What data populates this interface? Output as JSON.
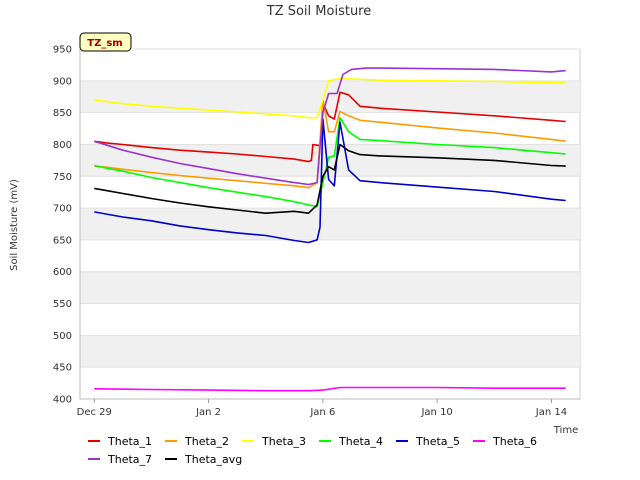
{
  "chart_data": {
    "type": "line",
    "title": "TZ Soil Moisture",
    "badge": "TZ_sm",
    "xlabel": "Time",
    "ylabel": "Soil Moisture (mV)",
    "ylim": [
      400,
      950
    ],
    "yticks": [
      400,
      450,
      500,
      550,
      600,
      650,
      700,
      750,
      800,
      850,
      900,
      950
    ],
    "xlim": [
      -0.5,
      17.0
    ],
    "xticks": [
      {
        "label": "Dec 29",
        "value": 0
      },
      {
        "label": "Jan 2",
        "value": 4
      },
      {
        "label": "Jan 6",
        "value": 8
      },
      {
        "label": "Jan 10",
        "value": 12
      },
      {
        "label": "Jan 14",
        "value": 16
      }
    ],
    "grid": "horizontal bands",
    "legend_position": "bottom",
    "series": [
      {
        "name": "Theta_1",
        "color": "#e60000",
        "x": [
          0,
          0.5,
          1,
          2,
          3,
          4,
          5,
          6,
          7,
          7.5,
          7.6,
          7.65,
          7.9,
          8.0,
          8.2,
          8.4,
          8.6,
          8.9,
          9.3,
          10,
          12,
          14,
          16,
          16.5
        ],
        "y": [
          805,
          802,
          800,
          795,
          791,
          788,
          785,
          781,
          777,
          773,
          775,
          800,
          798,
          865,
          845,
          840,
          882,
          878,
          860,
          857,
          851,
          845,
          838,
          836
        ]
      },
      {
        "name": "Theta_2",
        "color": "#ff9900",
        "x": [
          0,
          0.5,
          1,
          2,
          3,
          4,
          5,
          6,
          7,
          7.5,
          7.8,
          8.0,
          8.2,
          8.4,
          8.6,
          8.9,
          9.3,
          10,
          12,
          14,
          16,
          16.5
        ],
        "y": [
          766,
          764,
          761,
          756,
          751,
          747,
          743,
          739,
          735,
          732,
          740,
          870,
          820,
          820,
          852,
          845,
          838,
          835,
          826,
          818,
          808,
          805
        ]
      },
      {
        "name": "Theta_3",
        "color": "#ffff00",
        "x": [
          0,
          0.5,
          1,
          2,
          3,
          4,
          5,
          6,
          7,
          7.5,
          7.8,
          8.0,
          8.2,
          8.5,
          9,
          10,
          12,
          14,
          16,
          16.5
        ],
        "y": [
          870,
          867,
          864,
          860,
          857,
          854,
          851,
          848,
          845,
          842,
          842,
          870,
          900,
          903,
          903,
          901,
          900,
          899,
          897,
          897
        ]
      },
      {
        "name": "Theta_4",
        "color": "#00ff00",
        "x": [
          0,
          0.5,
          1,
          2,
          3,
          4,
          5,
          6,
          7,
          7.5,
          7.8,
          8.0,
          8.2,
          8.4,
          8.6,
          8.9,
          9.3,
          10,
          12,
          14,
          16,
          16.5
        ],
        "y": [
          767,
          762,
          758,
          748,
          740,
          732,
          725,
          718,
          710,
          705,
          702,
          740,
          780,
          782,
          842,
          820,
          808,
          806,
          800,
          795,
          787,
          785
        ]
      },
      {
        "name": "Theta_5",
        "color": "#0000cc",
        "x": [
          0,
          0.5,
          1,
          2,
          3,
          4,
          5,
          6,
          7,
          7.5,
          7.8,
          7.9,
          8.0,
          8.2,
          8.4,
          8.6,
          8.9,
          9.3,
          10,
          12,
          14,
          16,
          16.5
        ],
        "y": [
          694,
          690,
          686,
          680,
          672,
          666,
          661,
          657,
          649,
          646,
          650,
          670,
          840,
          745,
          735,
          835,
          760,
          743,
          740,
          733,
          726,
          714,
          712
        ]
      },
      {
        "name": "Theta_6",
        "color": "#ff00ff",
        "x": [
          0,
          2,
          4,
          6,
          7.5,
          8.0,
          8.6,
          9,
          10,
          12,
          14,
          16,
          16.5
        ],
        "y": [
          416,
          415,
          414,
          413,
          413,
          414,
          418,
          418,
          418,
          418,
          417,
          417,
          417
        ]
      },
      {
        "name": "Theta_7",
        "color": "#9933cc",
        "x": [
          0,
          0.5,
          1,
          2,
          3,
          4,
          5,
          6,
          7,
          7.5,
          7.8,
          8.0,
          8.2,
          8.5,
          8.7,
          9.0,
          9.5,
          10,
          12,
          14,
          16,
          16.5
        ],
        "y": [
          805,
          798,
          791,
          780,
          770,
          762,
          754,
          747,
          740,
          737,
          740,
          850,
          880,
          880,
          910,
          918,
          920,
          920,
          919,
          918,
          914,
          916
        ]
      },
      {
        "name": "Theta_avg",
        "color": "#000000",
        "x": [
          0,
          0.5,
          1,
          2,
          3,
          4,
          5,
          6,
          7,
          7.5,
          7.8,
          8.0,
          8.2,
          8.4,
          8.6,
          8.9,
          9.3,
          10,
          12,
          14,
          16,
          16.5
        ],
        "y": [
          731,
          727,
          723,
          715,
          708,
          702,
          697,
          692,
          695,
          692,
          705,
          750,
          765,
          760,
          800,
          790,
          784,
          782,
          779,
          775,
          767,
          766
        ]
      }
    ]
  }
}
